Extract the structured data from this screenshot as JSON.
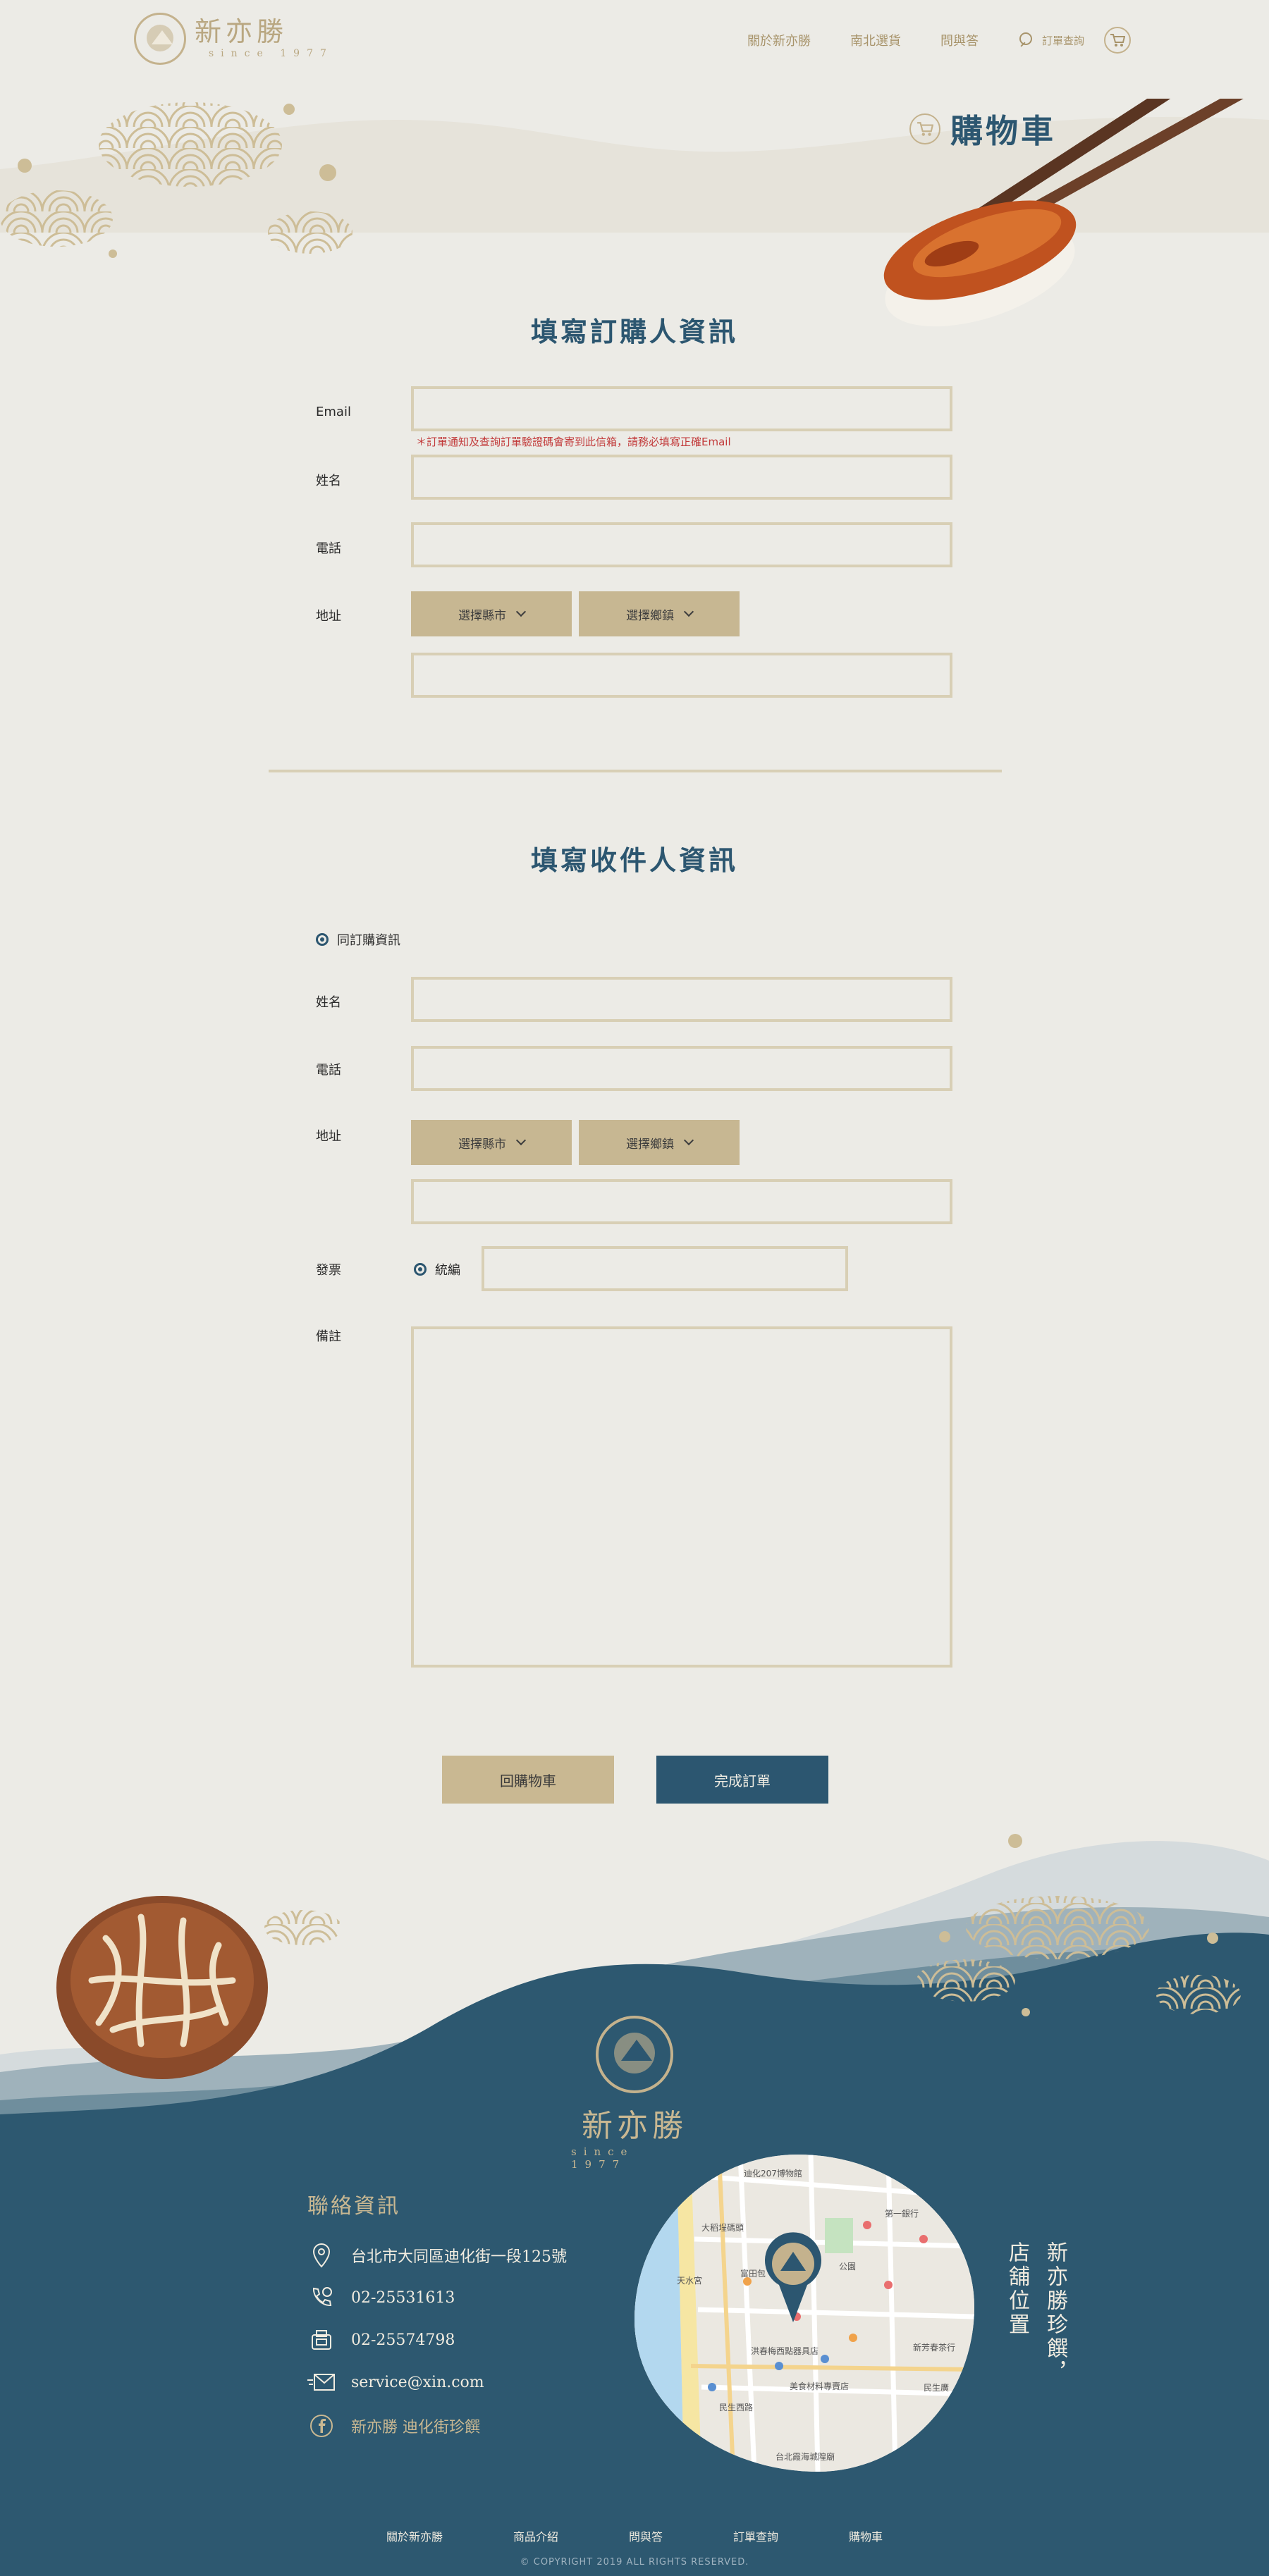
{
  "header": {
    "brand_name": "新亦勝",
    "brand_since": "since 1977",
    "nav": [
      "關於新亦勝",
      "南北選貨",
      "問與答"
    ],
    "order_query": "訂單查詢"
  },
  "hero": {
    "title": "購物車"
  },
  "buyer_section": {
    "title": "填寫訂購人資訊",
    "email_label": "Email",
    "email_note": "＊訂單通知及查詢訂單驗證碼會寄到此信箱，請務必填寫正確Email",
    "name_label": "姓名",
    "phone_label": "電話",
    "address_label": "地址",
    "city_select": "選擇縣市",
    "town_select": "選擇鄉鎮"
  },
  "receiver_section": {
    "title": "填寫收件人資訊",
    "same_as_buyer": "同訂購資訊",
    "name_label": "姓名",
    "phone_label": "電話",
    "address_label": "地址",
    "city_select": "選擇縣市",
    "town_select": "選擇鄉鎮",
    "invoice_label": "發票",
    "invoice_option": "統編",
    "remark_label": "備註"
  },
  "actions": {
    "back": "回購物車",
    "submit": "完成訂單"
  },
  "footer": {
    "brand_name": "新亦勝",
    "brand_since": "since 1977",
    "contact_title": "聯絡資訊",
    "address": "台北市大同區迪化街一段125號",
    "phone": "02-25531613",
    "fax": "02-25574798",
    "email": "service@xin.com",
    "facebook": "新亦勝 迪化街珍饌",
    "map_caption_1": "新亦勝珍饌，",
    "map_caption_2": "店舖位置",
    "map_labels": [
      "迪化207博物館",
      "大稻埕碼頭",
      "第一銀行",
      "天水宮",
      "富田包",
      "公園",
      "洪春梅西點器具店",
      "美食材料專賣店",
      "民生西路",
      "台北霞海城隍廟",
      "新芳春茶行",
      "民生廣"
    ],
    "nav": [
      "關於新亦勝",
      "商品介紹",
      "問與答",
      "訂單查詢",
      "購物車"
    ],
    "copyright": "© COPYRIGHT 2019 ALL RIGHTS RESERVED."
  },
  "colors": {
    "navy": "#2c5670",
    "gold": "#c4b28d",
    "paper": "#ecebe6",
    "alert": "#c23a3a"
  }
}
